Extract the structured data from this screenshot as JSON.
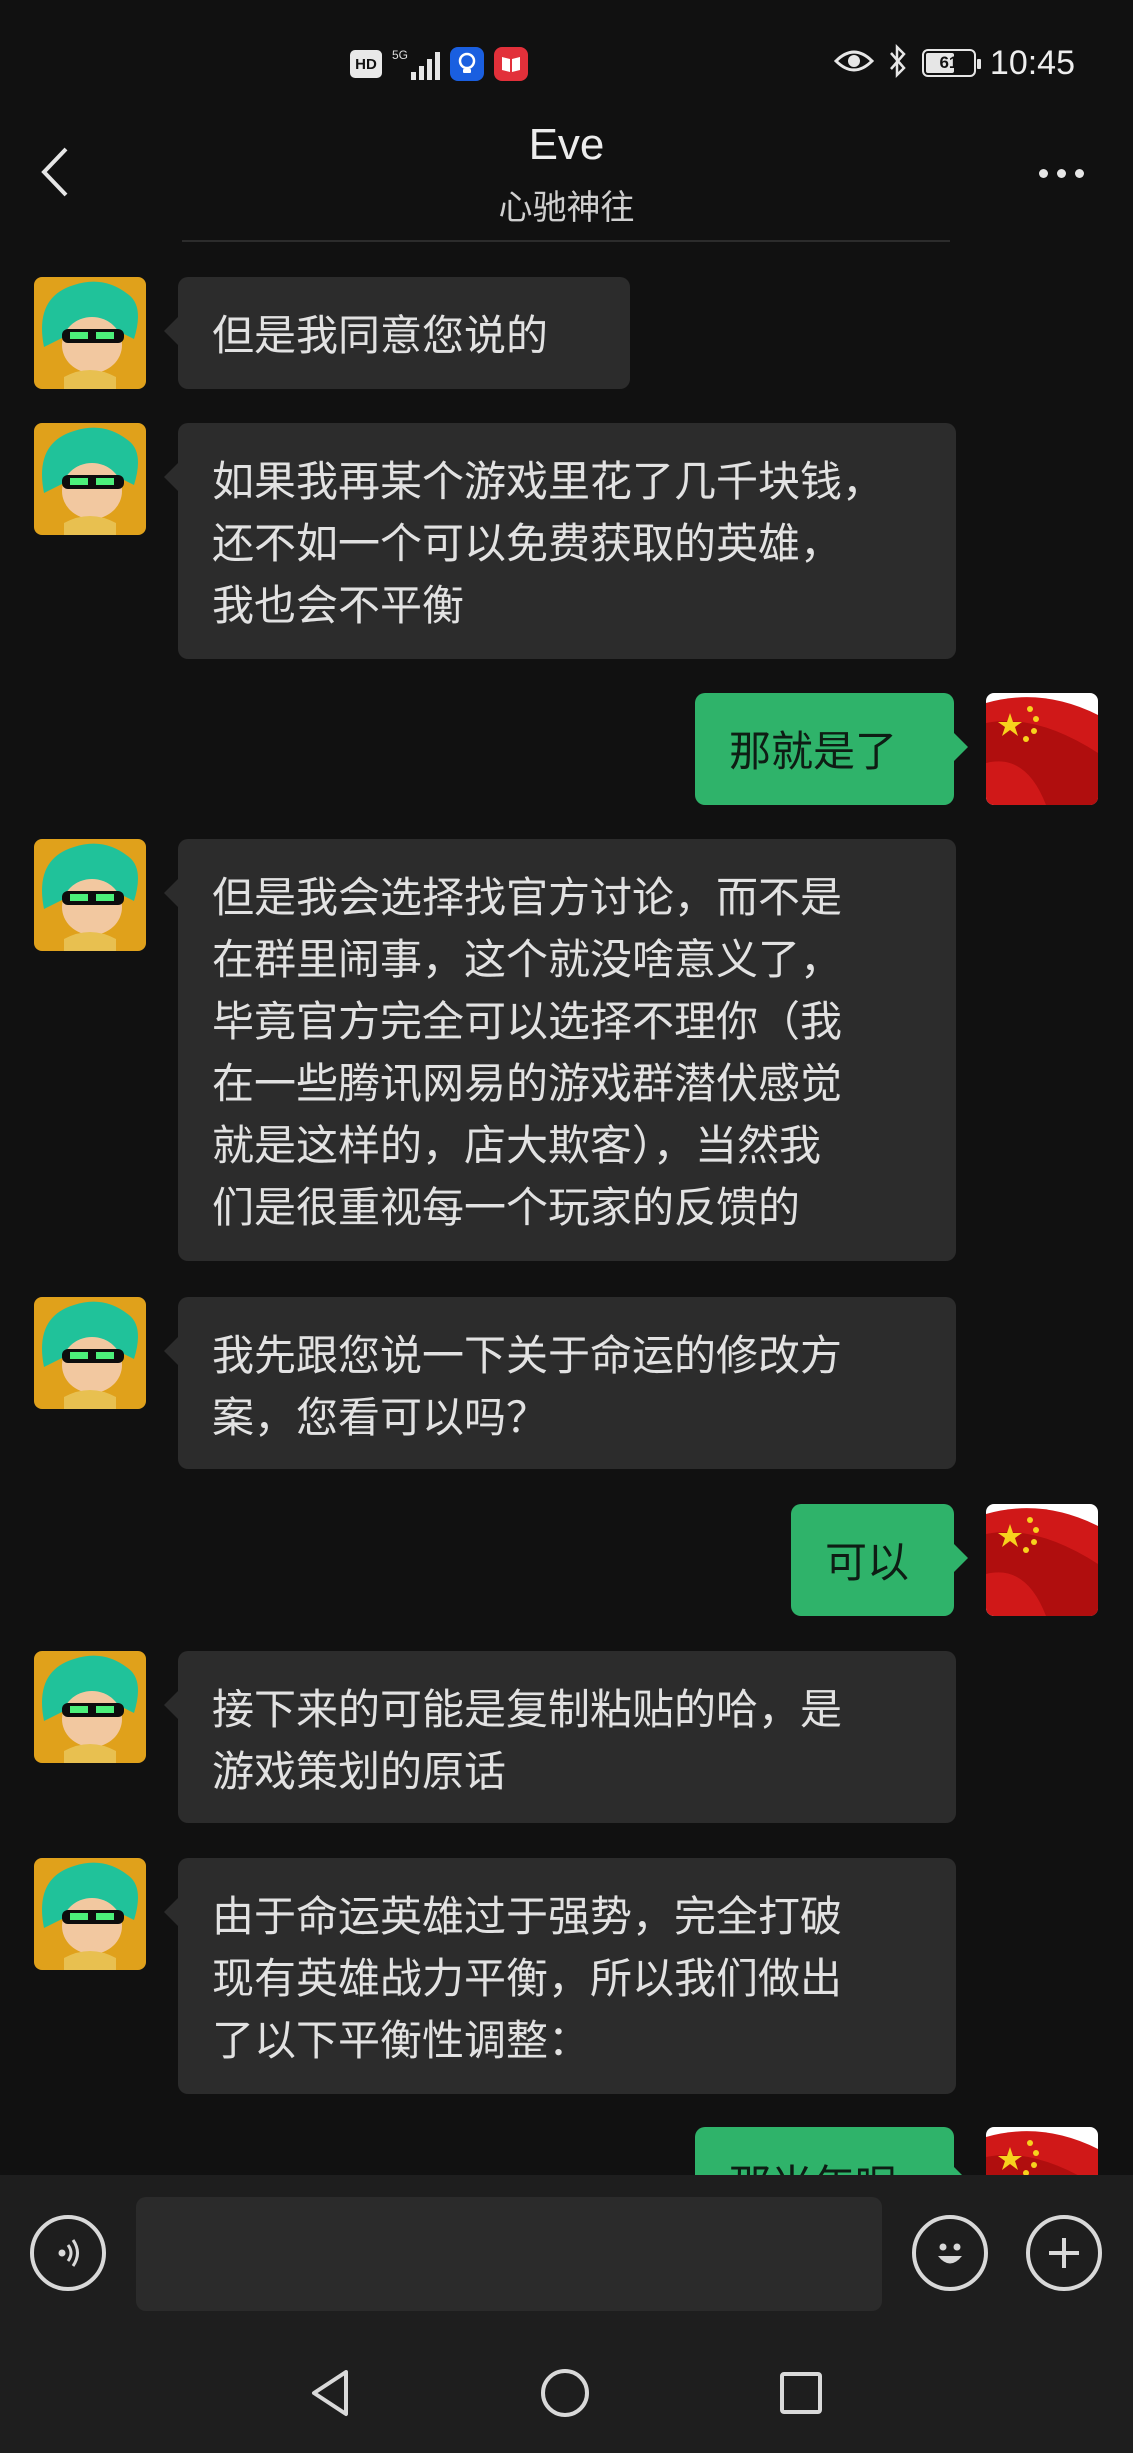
{
  "status_bar": {
    "hd_label": "HD",
    "network_label": "5G",
    "battery_percent": "61",
    "battery_level": 0.61,
    "time": "10:45",
    "icons": [
      "hd-icon",
      "signal-icon",
      "app-lightbulb-icon",
      "app-book-icon",
      "eye-icon",
      "bluetooth-icon",
      "battery-icon"
    ]
  },
  "header": {
    "title": "Eve",
    "subtitle": "心驰神往",
    "back_icon": "chevron-left-icon",
    "more_icon": "more-dots-icon"
  },
  "colors": {
    "background": "#111111",
    "incoming_bubble": "#2c2c2c",
    "outgoing_bubble": "#2fb36a",
    "text": "#e2e2e2"
  },
  "messages": [
    {
      "side": "in",
      "text": "但是我同意您说的"
    },
    {
      "side": "in",
      "text": "如果我再某个游戏里花了几千块钱，\n还不如一个可以免费获取的英雄，\n我也会不平衡"
    },
    {
      "side": "out",
      "text": "那就是了"
    },
    {
      "side": "in",
      "text": "但是我会选择找官方讨论，而不是\n在群里闹事，这个就没啥意义了，\n毕竟官方完全可以选择不理你（我\n在一些腾讯网易的游戏群潜伏感觉\n就是这样的，店大欺客），当然我\n们是很重视每一个玩家的反馈的"
    },
    {
      "side": "in",
      "text": "我先跟您说一下关于命运的修改方\n案，您看可以吗？"
    },
    {
      "side": "out",
      "text": "可以"
    },
    {
      "side": "in",
      "text": "接下来的可能是复制粘贴的哈，是\n游戏策划的原话"
    },
    {
      "side": "in",
      "text": "由于命运英雄过于强势，完全打破\n现有英雄战力平衡，所以我们做出\n了以下平衡性调整："
    },
    {
      "side": "out",
      "text": "那当年呢"
    }
  ],
  "input_bar": {
    "value": "",
    "voice_icon": "voice-icon",
    "emoji_icon": "emoji-icon",
    "plus_icon": "plus-icon"
  },
  "nav_bar": {
    "icons": [
      "nav-back-icon",
      "nav-home-icon",
      "nav-recent-icon"
    ]
  }
}
